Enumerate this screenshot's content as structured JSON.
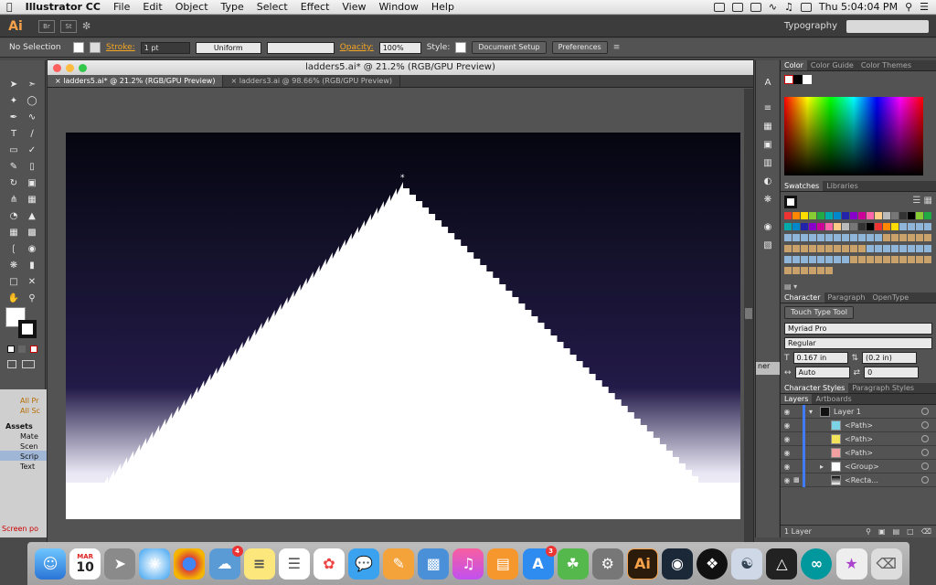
{
  "menubar": {
    "apple": "",
    "app_name": "Illustrator CC",
    "menus": [
      "File",
      "Edit",
      "Object",
      "Type",
      "Select",
      "Effect",
      "View",
      "Window",
      "Help"
    ],
    "clock": "Thu 5:04:04 PM"
  },
  "appbar": {
    "logo": "Ai",
    "bridge_icon": "Br",
    "stock_icon": "St",
    "workspace": "Typography"
  },
  "controlbar": {
    "selection": "No Selection",
    "stroke_label": "Stroke:",
    "stroke_weight": "1 pt",
    "stroke_profile": "Uniform",
    "opacity_label": "Opacity:",
    "opacity_value": "100%",
    "style_label": "Style:",
    "doc_setup": "Document Setup",
    "preferences": "Preferences"
  },
  "document": {
    "window_title": "ladders5.ai* @ 21.2% (RGB/GPU Preview)",
    "tabs": [
      {
        "label": "ladders5.ai* @ 21.2% (RGB/GPU Preview)",
        "active": true
      },
      {
        "label": "ladders3.ai @ 98.66% (RGB/GPU Preview)",
        "active": false
      }
    ]
  },
  "leftpanel": {
    "items": [
      "All Pr",
      "All Sc"
    ],
    "assets_label": "Assets",
    "folders": [
      "Mate",
      "Scen",
      "Scrip",
      "Text"
    ],
    "status": "Screen po"
  },
  "panels": {
    "color_tabs": [
      "Color",
      "Color Guide",
      "Color Themes"
    ],
    "swatch_tabs": [
      "Swatches",
      "Libraries"
    ],
    "char_tabs": [
      "Character",
      "Paragraph",
      "OpenType"
    ],
    "touch_type": "Touch Type Tool",
    "font_family": "Myriad Pro",
    "font_style": "Regular",
    "font_size": "0.167 in",
    "leading": "(0.2 in)",
    "kerning": "Auto",
    "tracking": "0",
    "style_tabs": [
      "Character Styles",
      "Paragraph Styles"
    ],
    "layer_tabs": [
      "Layers",
      "Artboards"
    ],
    "layers": [
      {
        "name": "Layer 1",
        "indent": 0
      },
      {
        "name": "<Path>",
        "indent": 1
      },
      {
        "name": "<Path>",
        "indent": 1
      },
      {
        "name": "<Path>",
        "indent": 1
      },
      {
        "name": "<Group>",
        "indent": 1
      },
      {
        "name": "<Recta...",
        "indent": 1
      }
    ],
    "layer_count": "1 Layer",
    "partial_label": "ner"
  },
  "dock": {
    "calendar_month": "MAR",
    "calendar_day": "10",
    "badge_1": "4",
    "badge_2": "3",
    "illustrator_label": "Ai"
  }
}
